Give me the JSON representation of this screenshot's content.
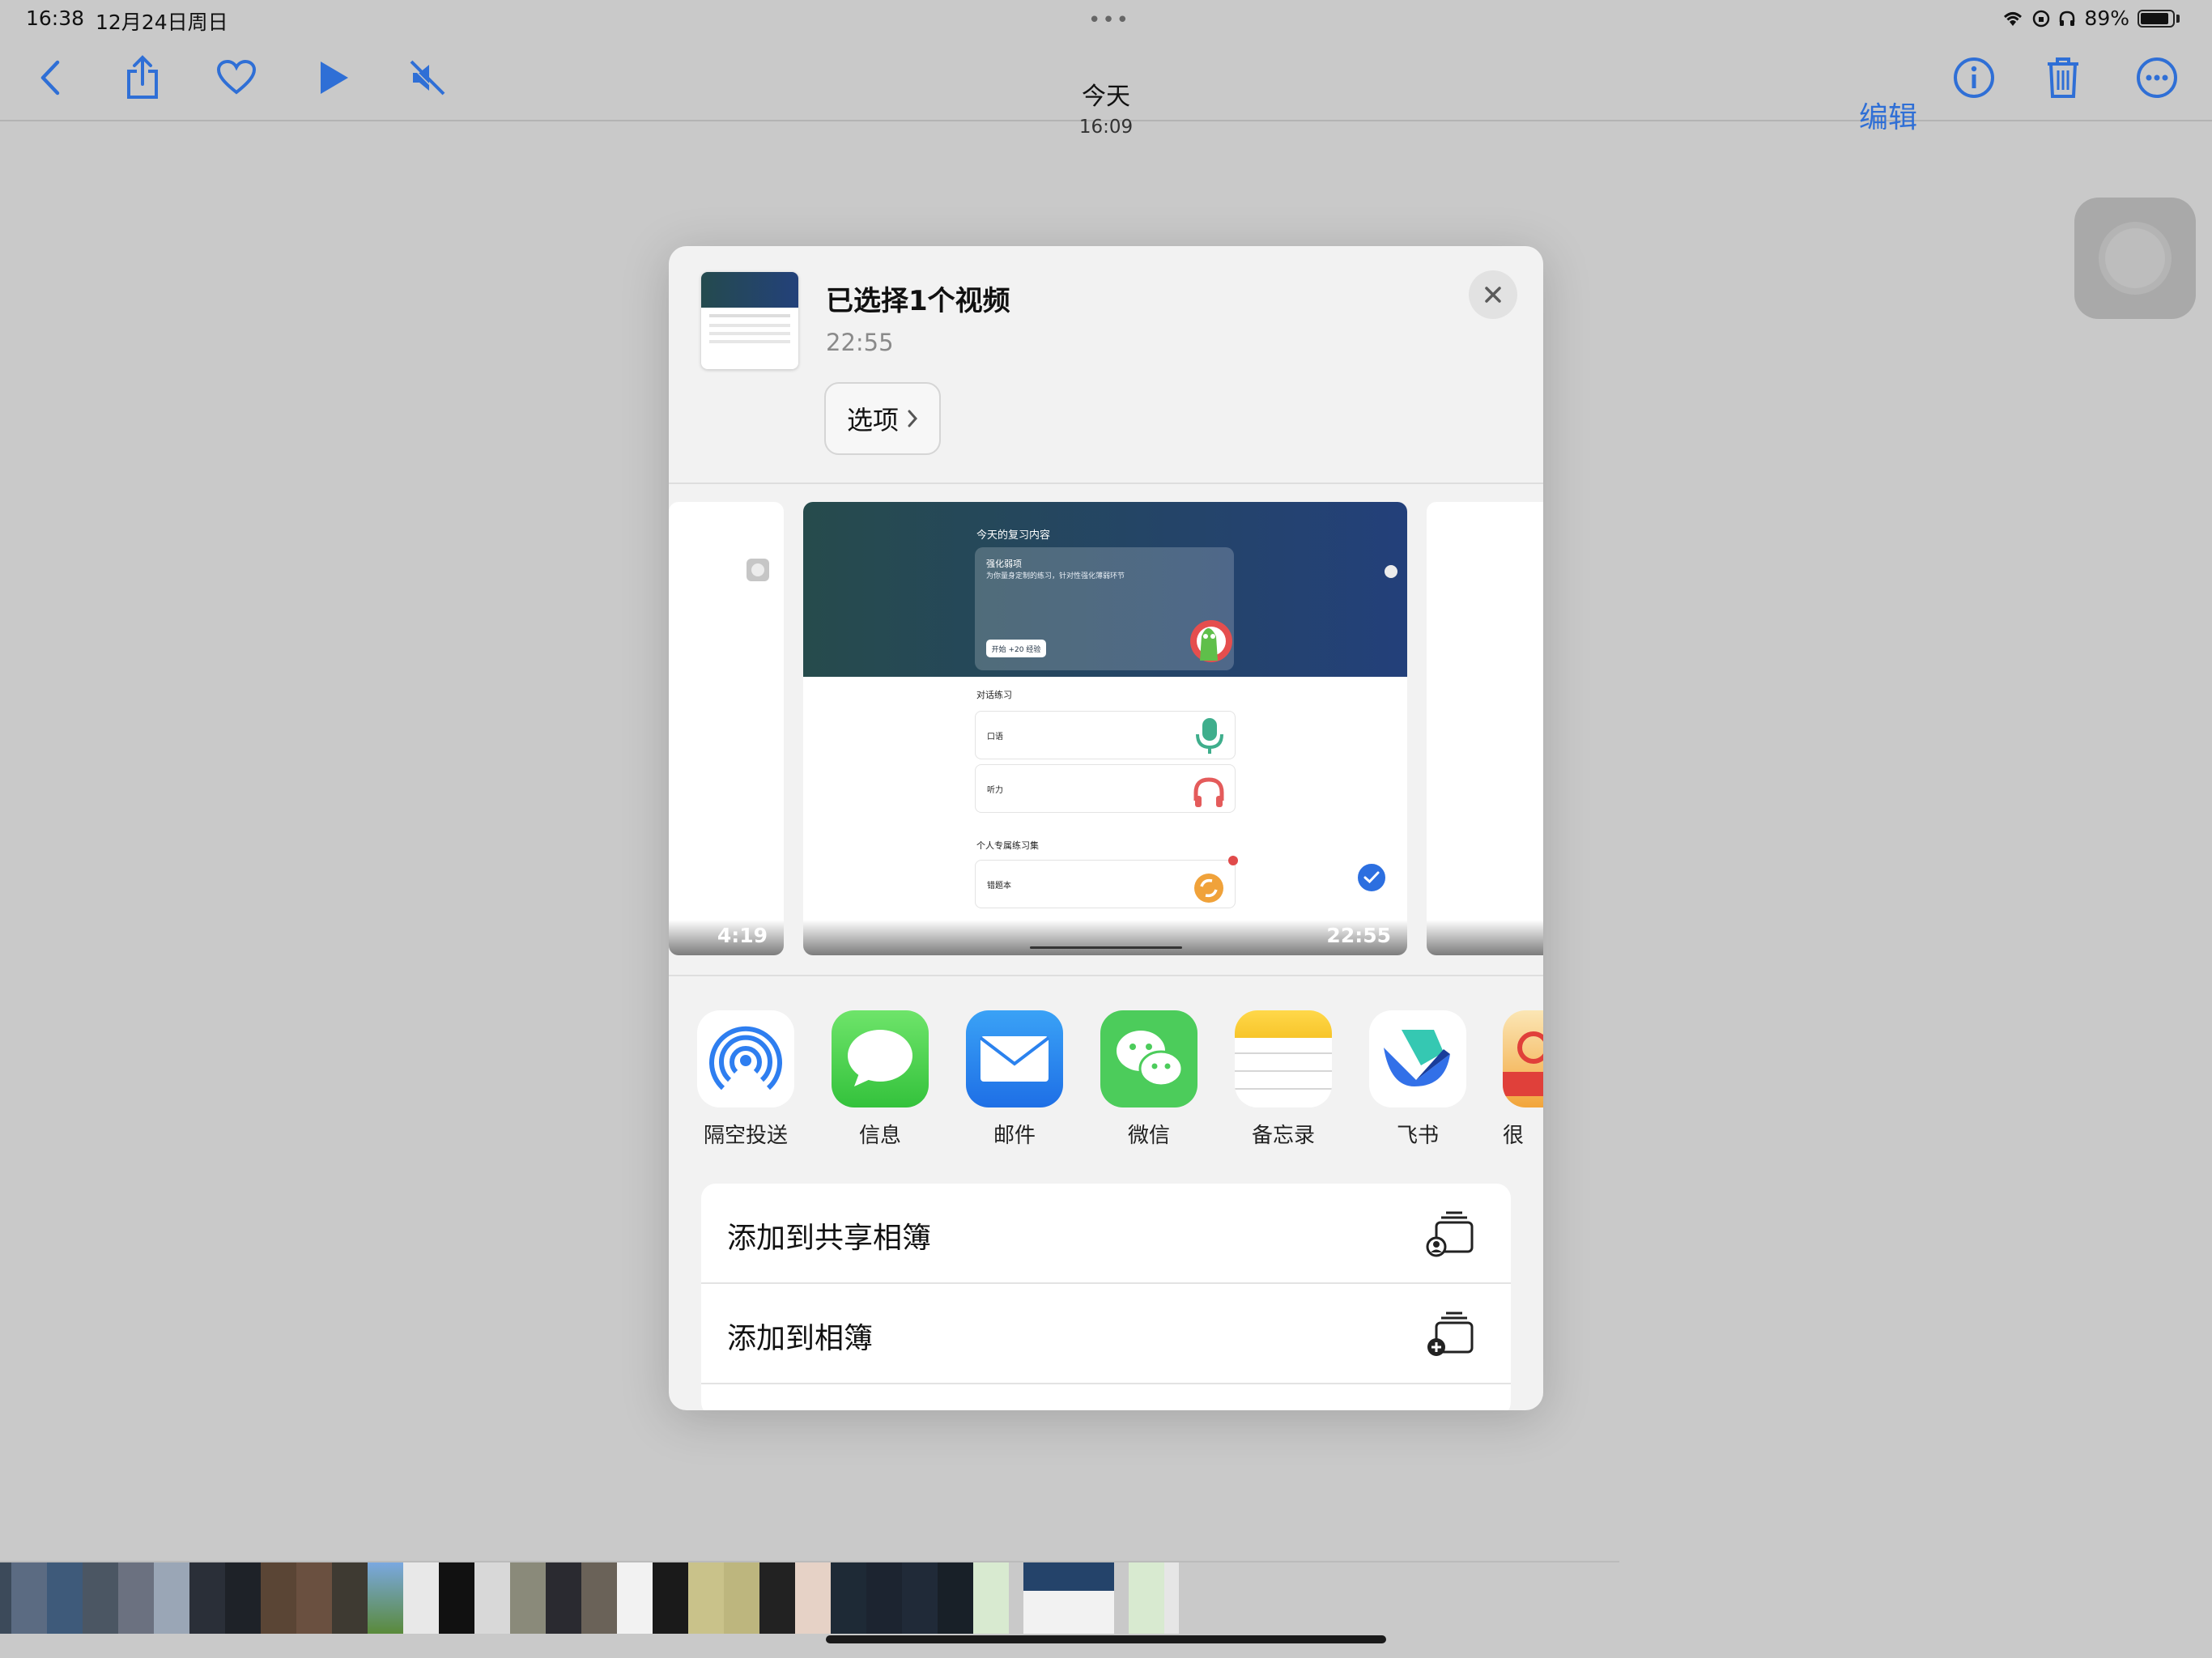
{
  "status_bar": {
    "time": "16:38",
    "date": "12月24日周日",
    "battery": "89%"
  },
  "toolbar": {
    "title": "今天",
    "subtitle": "16:09",
    "edit_label": "编辑"
  },
  "sheet": {
    "title": "已选择1个视频",
    "duration": "22:55",
    "options_label": "选项"
  },
  "preview": {
    "left_duration": "4:19",
    "main_duration": "22:55",
    "main": {
      "header_title": "今天的复习内容",
      "card_title": "强化弱项",
      "card_sub": "为你量身定制的练习，针对性强化薄弱环节",
      "card_button": "开始 +20 经验",
      "section1": "对话练习",
      "row1": "口语",
      "row2": "听力",
      "section2": "个人专属练习集",
      "row3": "错题本"
    }
  },
  "apps": [
    {
      "label": "隔空投送",
      "icon": "airdrop-icon"
    },
    {
      "label": "信息",
      "icon": "messages-icon"
    },
    {
      "label": "邮件",
      "icon": "mail-icon"
    },
    {
      "label": "微信",
      "icon": "wechat-icon"
    },
    {
      "label": "备忘录",
      "icon": "notes-icon"
    },
    {
      "label": "飞书",
      "icon": "feishu-icon"
    },
    {
      "label": "很",
      "icon": "partial-app-icon"
    }
  ],
  "actions": [
    {
      "label": "添加到共享相簿",
      "icon": "shared-album-icon"
    },
    {
      "label": "添加到相簿",
      "icon": "add-album-icon"
    }
  ],
  "colors": {
    "accent": "#2f6fd6",
    "background": "#c9c9c9",
    "sheet": "#f2f2f2"
  }
}
